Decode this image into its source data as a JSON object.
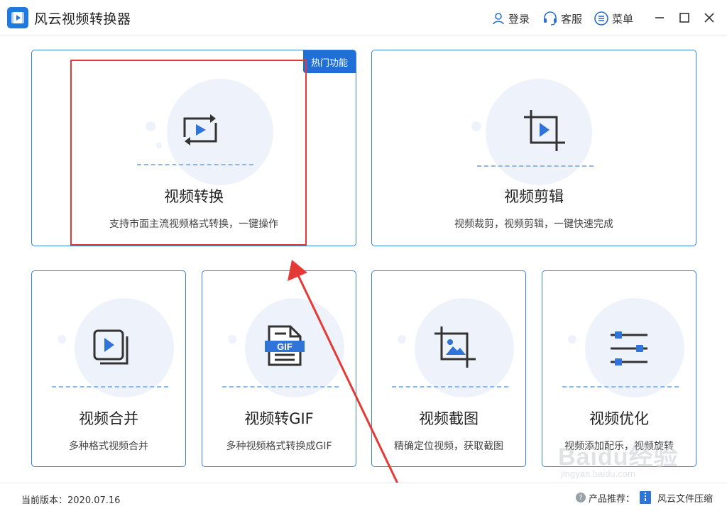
{
  "app": {
    "title": "风云视频转换器"
  },
  "top_actions": {
    "login": "登录",
    "service": "客服",
    "menu": "菜单"
  },
  "hot_badge": "热门功能",
  "cards": [
    {
      "id": "convert",
      "title": "视频转换",
      "desc": "支持市面主流视频格式转换，一键操作",
      "icon": "convert-play-icon"
    },
    {
      "id": "edit",
      "title": "视频剪辑",
      "desc": "视频裁剪，视频剪辑，一键快速完成",
      "icon": "crop-play-icon"
    },
    {
      "id": "merge",
      "title": "视频合并",
      "desc": "多种格式视频合并",
      "icon": "stack-play-icon"
    },
    {
      "id": "gif",
      "title": "视频转GIF",
      "desc": "多种视频格式转换成GIF",
      "icon": "gif-file-icon",
      "icon_text": "GIF"
    },
    {
      "id": "screenshot",
      "title": "视频截图",
      "desc": "精确定位视频，获取截图",
      "icon": "crop-image-icon"
    },
    {
      "id": "optimize",
      "title": "视频优化",
      "desc": "视频添加配乐，视频旋转",
      "icon": "sliders-icon"
    }
  ],
  "footer": {
    "version_label": "当前版本：2020.07.16",
    "recommend_label": "产品推荐：",
    "product": "风云文件压缩"
  },
  "watermark": {
    "text": "Baidu经验",
    "sub": "jingyan.baidu.com"
  },
  "colors": {
    "accent": "#1f6fd6",
    "highlight": "#e53935",
    "card_border": "#3b82d6"
  }
}
